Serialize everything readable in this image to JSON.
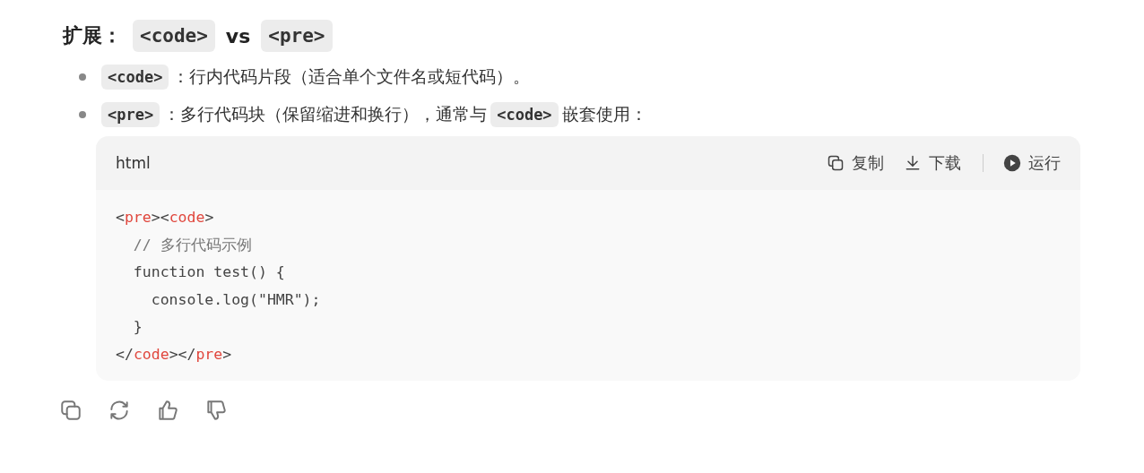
{
  "heading": [
    {
      "kind": "text",
      "text": "扩展："
    },
    {
      "kind": "code",
      "text": "<code>"
    },
    {
      "kind": "text",
      "text": "vs"
    },
    {
      "kind": "code",
      "text": "<pre>"
    }
  ],
  "bullets": [
    {
      "parts": [
        {
          "kind": "code",
          "text": "<code>"
        },
        {
          "kind": "text",
          "text": "：行内代码片段（适合单个文件名或短代码）。"
        }
      ]
    },
    {
      "parts": [
        {
          "kind": "code",
          "text": "<pre>"
        },
        {
          "kind": "text",
          "text": "：多行代码块（保留缩进和换行），通常与"
        },
        {
          "kind": "code",
          "text": "<code>"
        },
        {
          "kind": "text",
          "text": "嵌套使用："
        }
      ]
    }
  ],
  "code_block": {
    "language": "html",
    "actions": [
      {
        "kind": "copy",
        "label": "复制"
      },
      {
        "kind": "download",
        "label": "下载"
      },
      {
        "kind": "run",
        "label": "运行"
      }
    ],
    "lines": [
      [
        {
          "kind": "punct",
          "text": "<"
        },
        {
          "kind": "tag",
          "text": "pre"
        },
        {
          "kind": "punct",
          "text": "><"
        },
        {
          "kind": "tag",
          "text": "code"
        },
        {
          "kind": "punct",
          "text": ">"
        }
      ],
      [
        {
          "kind": "comment",
          "text": "  // 多行代码示例"
        }
      ],
      [
        {
          "kind": "plain",
          "text": "  function test() {"
        }
      ],
      [
        {
          "kind": "plain",
          "text": "    console.log(\"HMR\");"
        }
      ],
      [
        {
          "kind": "plain",
          "text": "  }"
        }
      ],
      [
        {
          "kind": "punct",
          "text": "</"
        },
        {
          "kind": "tag",
          "text": "code"
        },
        {
          "kind": "punct",
          "text": "></"
        },
        {
          "kind": "tag",
          "text": "pre"
        },
        {
          "kind": "punct",
          "text": ">"
        }
      ]
    ]
  },
  "feedback": [
    {
      "kind": "copy"
    },
    {
      "kind": "regenerate"
    },
    {
      "kind": "like"
    },
    {
      "kind": "dislike"
    }
  ]
}
